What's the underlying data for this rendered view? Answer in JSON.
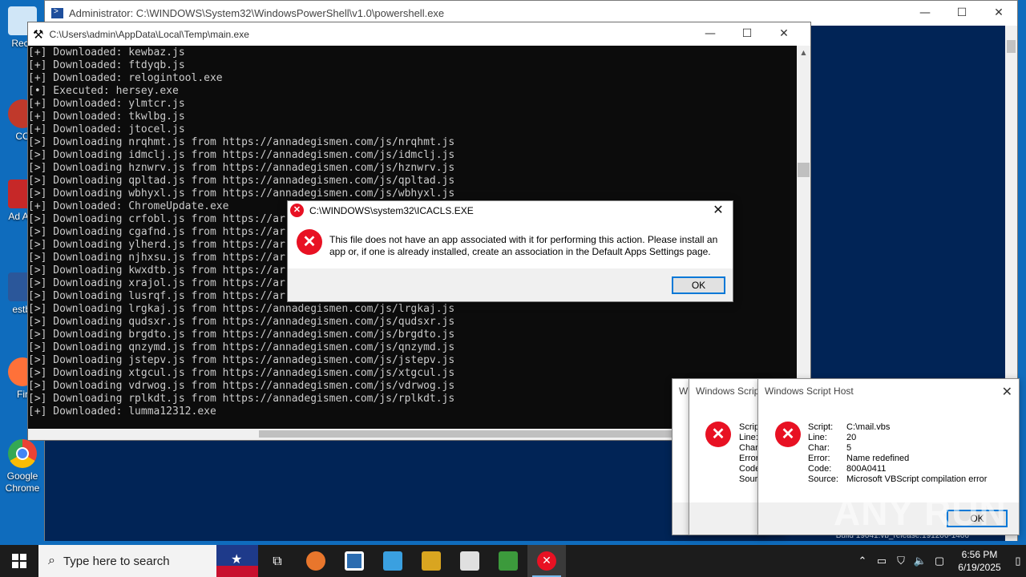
{
  "desktop": {
    "icons": [
      {
        "label": "Recy",
        "color": "#d0e6f7"
      },
      {
        "label": "CC",
        "color": "#c0392b"
      },
      {
        "label": "Ad Acr",
        "color": "#c62828"
      },
      {
        "label": "estbl",
        "color": "#2b579a"
      },
      {
        "label": "Fir",
        "color": "#ff7139"
      },
      {
        "label": "Google Chrome",
        "color": "#4285f4"
      }
    ]
  },
  "powershell": {
    "title": "Administrator: C:\\WINDOWS\\System32\\WindowsPowerShell\\v1.0\\powershell.exe",
    "status": "Build 19041.vb_release.191206-1406"
  },
  "cmd": {
    "title": "C:\\Users\\admin\\AppData\\Local\\Temp\\main.exe",
    "lines": [
      "[+] Downloaded: kewbaz.js",
      "[+] Downloaded: ftdyqb.js",
      "[+] Downloaded: relogintool.exe",
      "[•] Executed: hersey.exe",
      "[+] Downloaded: ylmtcr.js",
      "[+] Downloaded: tkwlbg.js",
      "[+] Downloaded: jtocel.js",
      "[>] Downloading nrqhmt.js from https://annadegismen.com/js/nrqhmt.js",
      "[>] Downloading idmclj.js from https://annadegismen.com/js/idmclj.js",
      "[>] Downloading hznwrv.js from https://annadegismen.com/js/hznwrv.js",
      "[>] Downloading qpltad.js from https://annadegismen.com/js/qpltad.js",
      "[>] Downloading wbhyxl.js from https://annadegismen.com/js/wbhyxl.js",
      "[+] Downloaded: ChromeUpdate.exe",
      "[>] Downloading crfobl.js from https://ar",
      "[>] Downloading cgafnd.js from https://ar",
      "[>] Downloading ylherd.js from https://ar",
      "[>] Downloading njhxsu.js from https://ar",
      "[>] Downloading kwxdtb.js from https://ar",
      "[>] Downloading xrajol.js from https://ar",
      "[>] Downloading lusrqf.js from https://ar",
      "[>] Downloading lrgkaj.js from https://annadegismen.com/js/lrgkaj.js",
      "[>] Downloading qudsxr.js from https://annadegismen.com/js/qudsxr.js",
      "[>] Downloading brgdto.js from https://annadegismen.com/js/brgdto.js",
      "[>] Downloading qnzymd.js from https://annadegismen.com/js/qnzymd.js",
      "[>] Downloading jstepv.js from https://annadegismen.com/js/jstepv.js",
      "[>] Downloading xtgcul.js from https://annadegismen.com/js/xtgcul.js",
      "[>] Downloading vdrwog.js from https://annadegismen.com/js/vdrwog.js",
      "[>] Downloading rplkdt.js from https://annadegismen.com/js/rplkdt.js",
      "[+] Downloaded: lumma12312.exe"
    ]
  },
  "icacls_dialog": {
    "title": "C:\\WINDOWS\\system32\\ICACLS.EXE",
    "message": "This file does not have an app associated with it for performing this action. Please install an app or, if one is already installed, create an association in the Default Apps Settings page.",
    "ok_label": "OK"
  },
  "wsh_back1": {
    "title": "Wi"
  },
  "wsh_back2": {
    "title": "Windows Scrip",
    "keys": [
      "Scrip",
      "Line:",
      "Char",
      "Error",
      "Code",
      "Sour"
    ]
  },
  "wsh_front": {
    "title": "Windows Script Host",
    "rows": [
      {
        "k": "Script:",
        "v": "C:\\mail.vbs"
      },
      {
        "k": "Line:",
        "v": "20"
      },
      {
        "k": "Char:",
        "v": "5"
      },
      {
        "k": "Error:",
        "v": "Name redefined"
      },
      {
        "k": "Code:",
        "v": "800A0411"
      },
      {
        "k": "Source:",
        "v": "Microsoft VBScript compilation error"
      }
    ],
    "ok_label": "OK"
  },
  "watermark": "ANY RUN",
  "taskbar": {
    "search_placeholder": "Type here to search",
    "apps": [
      {
        "name": "task-view",
        "color": "#ffffff"
      },
      {
        "name": "basketball",
        "color": "#e8762c"
      },
      {
        "name": "app-blue",
        "color": "#2b6cb0"
      },
      {
        "name": "monitor",
        "color": "#3aa0e0"
      },
      {
        "name": "files",
        "color": "#d9a520"
      },
      {
        "name": "cert",
        "color": "#e0e0e0"
      },
      {
        "name": "chart",
        "color": "#3c9a3c"
      },
      {
        "name": "error",
        "color": "#e81123"
      }
    ],
    "time": "6:56 PM",
    "date": "6/19/2025"
  }
}
